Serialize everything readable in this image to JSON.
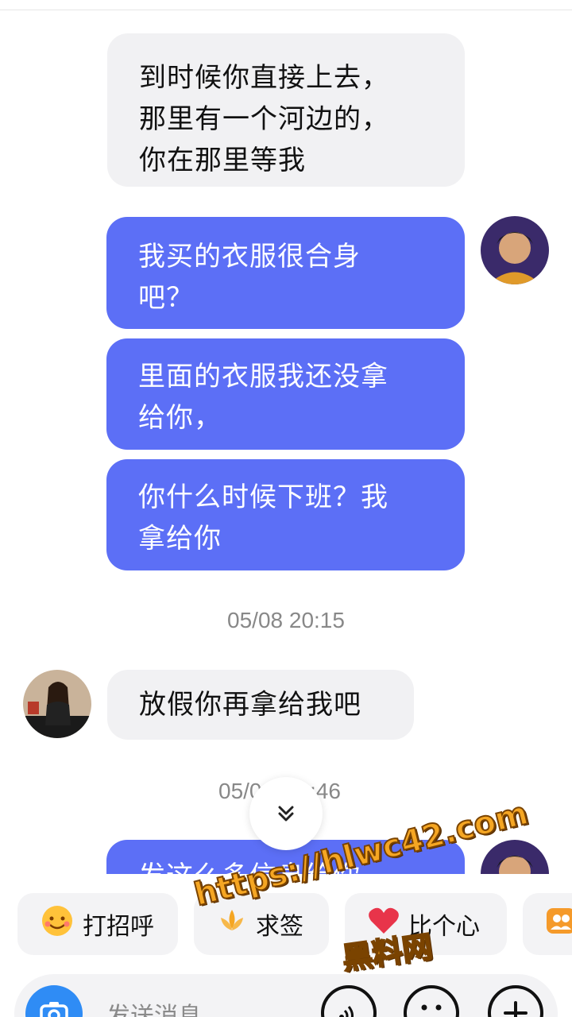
{
  "messages": [
    {
      "side": "in",
      "lines": [
        "到时候你直接上去，",
        "那里有一个河边的，",
        "你在那里等我"
      ]
    },
    {
      "side": "out",
      "lines": [
        "我买的衣服很合身",
        "吧？"
      ]
    },
    {
      "side": "out",
      "lines": [
        "里面的衣服我还没拿",
        "给你，"
      ]
    },
    {
      "side": "out",
      "lines": [
        "你什么时候下班？我",
        "拿给你"
      ]
    },
    {
      "side": "in",
      "lines": [
        "放假你再拿给我吧"
      ]
    },
    {
      "side": "out",
      "lines": [
        "发这么多信息给你"
      ]
    }
  ],
  "timestamps": [
    "05/08 20:15",
    "05/0",
    ":46"
  ],
  "quick_actions": [
    "打招呼",
    "求签",
    "比个心"
  ],
  "input": {
    "placeholder": "发送消息"
  },
  "watermark": {
    "url": "https://hlwc42.com",
    "site": "黑料网"
  },
  "colors": {
    "outgoing_bubble": "#5c6ff6",
    "incoming_bubble": "#f1f1f3",
    "camera_button": "#2f8cf5",
    "heart": "#e8344a"
  }
}
